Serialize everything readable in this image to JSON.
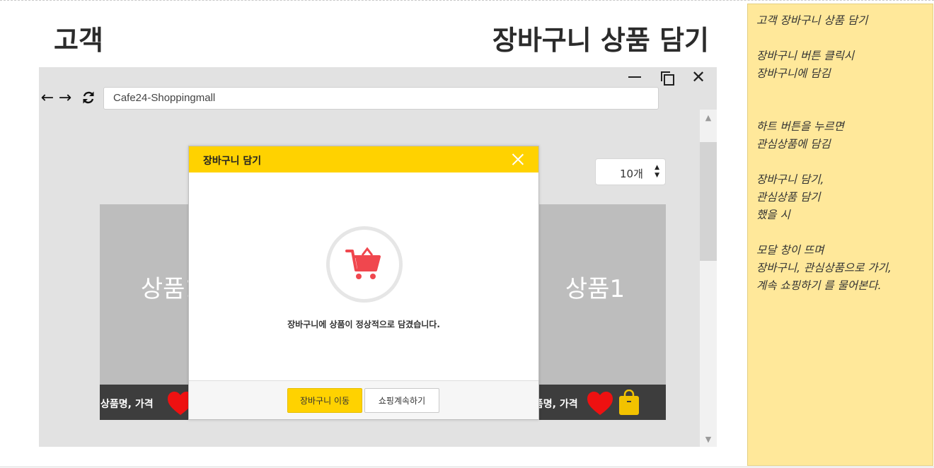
{
  "header": {
    "actor": "고객",
    "scenario": "장바구니 상품 담기"
  },
  "browser": {
    "window_controls": {
      "minimize_icon": "minimize-icon",
      "maximize_icon": "restore-icon",
      "close_icon": "close-icon"
    },
    "nav": {
      "back_icon": "arrow-left-icon",
      "forward_icon": "arrow-right-icon",
      "reload_icon": "reload-icon"
    },
    "address": "Cafe24-Shoppingmall"
  },
  "page": {
    "quantity_select": "10개",
    "products": [
      {
        "name": "상품1",
        "info": "상품명, 가격"
      },
      {
        "name": "상품1",
        "info": "상품명, 가격"
      }
    ]
  },
  "modal": {
    "title": "장바구니 담기",
    "message": "장바구니에 상품이 정상적으로 담겼습니다.",
    "primary_button": "장바구니 이동",
    "secondary_button": "쇼핑계속하기",
    "accent_color": "#ffd200",
    "cart_icon_color": "#f0474e"
  },
  "note": {
    "lines": [
      "고객 장바구니 상품 담기",
      "",
      "장바구니 버튼 클릭시",
      "장바구니에 담김",
      "",
      "",
      "하트 버튼을 누르면",
      "관심상품에 담김",
      "",
      "장바구니 담기,",
      "관심상품 담기",
      "했을 시",
      "",
      "모달 창이 뜨며",
      "장바구니, 관심상품으로 가기,",
      "계속 쇼핑하기 를 물어본다."
    ]
  }
}
